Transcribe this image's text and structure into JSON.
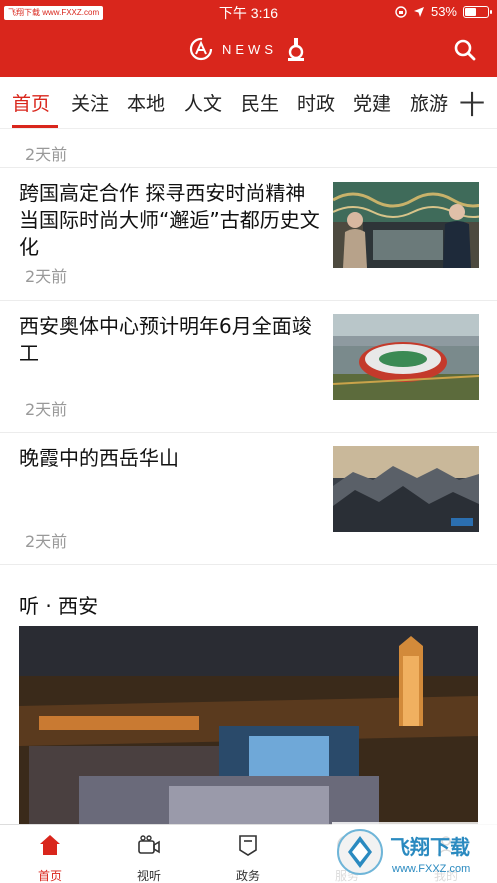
{
  "status_bar": {
    "watermark": "飞翔下载 www.FXXZ.com",
    "time": "下午 3:16",
    "battery": "53%",
    "battery_level": 0.53
  },
  "header": {
    "logo_text": "NEWS",
    "accent_color": "#d9261c"
  },
  "tabs": [
    {
      "label": "首页",
      "active": true
    },
    {
      "label": "关注",
      "active": false
    },
    {
      "label": "本地",
      "active": false
    },
    {
      "label": "人文",
      "active": false
    },
    {
      "label": "民生",
      "active": false
    },
    {
      "label": "时政",
      "active": false
    },
    {
      "label": "党建",
      "active": false
    },
    {
      "label": "旅游",
      "active": false
    }
  ],
  "tab_add_label": "十",
  "feed": {
    "top_time": "2天前",
    "articles": [
      {
        "title": "跨国高定合作 探寻西安时尚精神 当国际时尚大师“邂逅”古都历史文化",
        "time": "2天前"
      },
      {
        "title": "西安奥体中心预计明年6月全面竣工",
        "time": "2天前"
      },
      {
        "title": "晚霞中的西岳华山",
        "time": "2天前"
      }
    ]
  },
  "section": {
    "title": "听 · 西安"
  },
  "bottom_nav": [
    {
      "label": "首页",
      "icon": "home-icon",
      "active": true
    },
    {
      "label": "视听",
      "icon": "video-camera-icon",
      "active": false
    },
    {
      "label": "政务",
      "icon": "government-icon",
      "active": false
    },
    {
      "label": "服务",
      "icon": "service-icon",
      "active": false
    },
    {
      "label": "我的",
      "icon": "profile-icon",
      "active": false
    }
  ],
  "site_badge": {
    "name": "飞翔下载",
    "url": "www.FXXZ.com"
  }
}
